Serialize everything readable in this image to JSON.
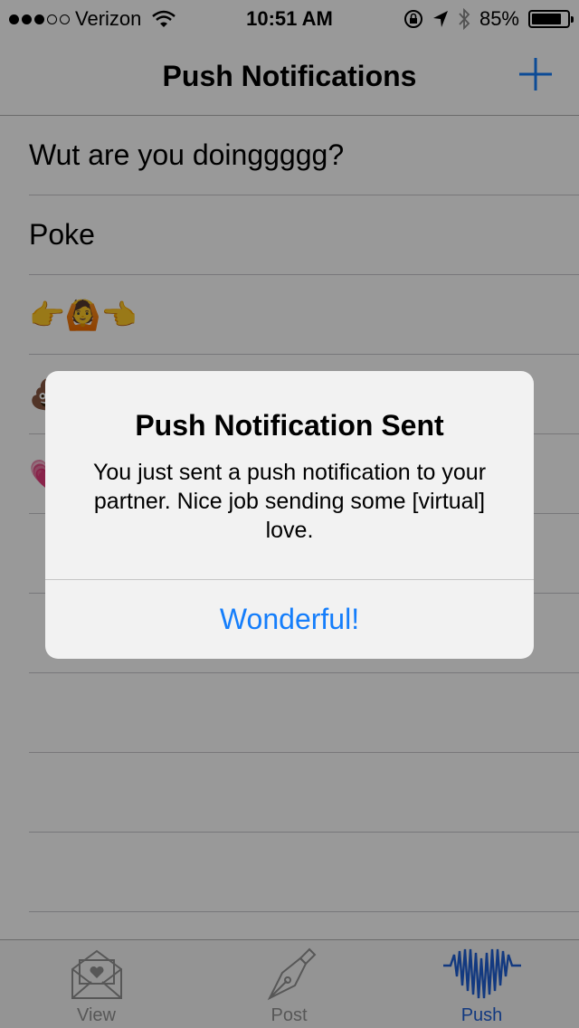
{
  "status_bar": {
    "carrier": "Verizon",
    "time": "10:51 AM",
    "battery_percent": "85%",
    "battery_level": 0.85,
    "signal_bars": 3,
    "signal_total": 5
  },
  "nav": {
    "title": "Push Notifications",
    "add_icon": "plus-icon"
  },
  "list": {
    "items": [
      {
        "label": "Wut are you doinggggg?"
      },
      {
        "label": "Poke"
      },
      {
        "label": "👉🙆👈"
      },
      {
        "label": "💩"
      },
      {
        "label": "💗"
      },
      {
        "label": ""
      },
      {
        "label": ""
      },
      {
        "label": ""
      },
      {
        "label": ""
      },
      {
        "label": ""
      }
    ]
  },
  "tab_bar": {
    "tabs": [
      {
        "label": "View",
        "icon": "envelope-heart-icon",
        "active": false
      },
      {
        "label": "Post",
        "icon": "fountain-pen-icon",
        "active": false
      },
      {
        "label": "Push",
        "icon": "heartbeat-icon",
        "active": true
      }
    ]
  },
  "alert": {
    "title": "Push Notification Sent",
    "message": "You just sent a push notification to your partner. Nice job sending some [virtual] love.",
    "button_label": "Wonderful!"
  },
  "colors": {
    "accent": "#157efb",
    "active_tab": "#1f5fd6",
    "inactive_tab": "#929292"
  }
}
